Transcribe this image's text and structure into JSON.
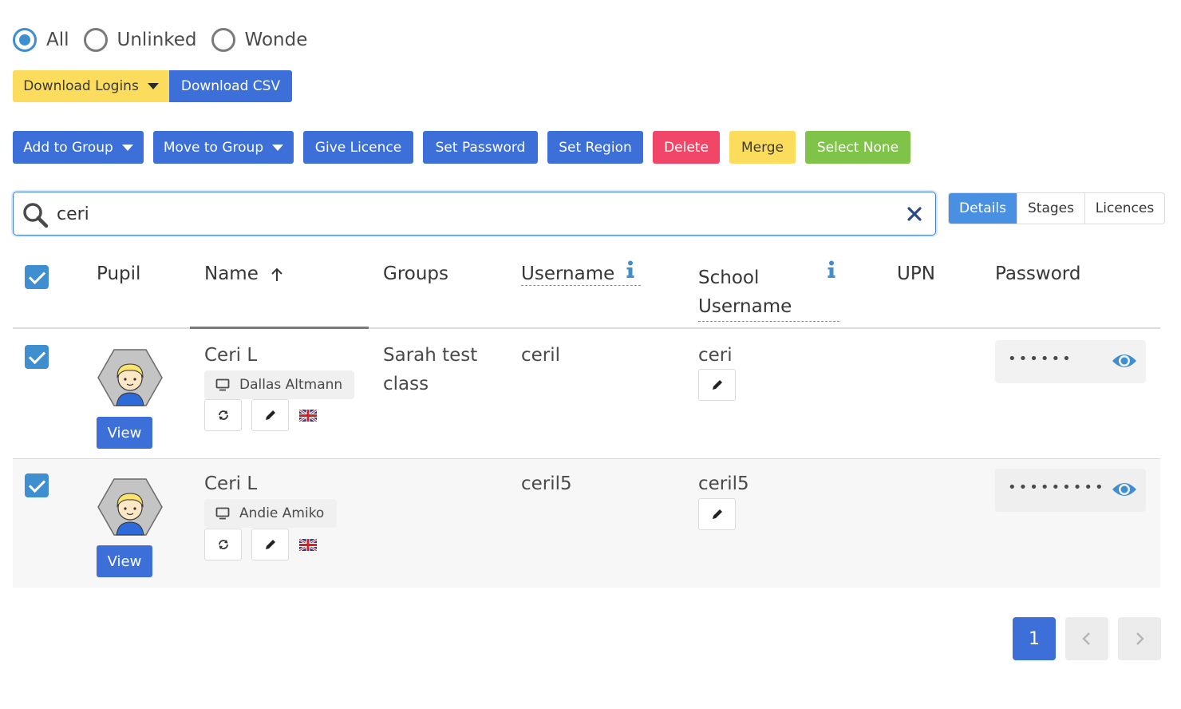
{
  "filters": {
    "options": [
      {
        "label": "All",
        "checked": true
      },
      {
        "label": "Unlinked",
        "checked": false
      },
      {
        "label": "Wonde",
        "checked": false
      }
    ]
  },
  "downloads": {
    "download_logins": "Download Logins",
    "download_csv": "Download CSV"
  },
  "actions": {
    "add_to_group": "Add to Group",
    "move_to_group": "Move to Group",
    "give_licence": "Give Licence",
    "set_password": "Set Password",
    "set_region": "Set Region",
    "delete": "Delete",
    "merge": "Merge",
    "select_none": "Select None"
  },
  "search": {
    "value": "ceri",
    "placeholder": ""
  },
  "view_tabs": [
    {
      "label": "Details",
      "active": true
    },
    {
      "label": "Stages",
      "active": false
    },
    {
      "label": "Licences",
      "active": false
    }
  ],
  "table": {
    "headers": {
      "pupil": "Pupil",
      "name": "Name",
      "groups": "Groups",
      "username": "Username",
      "school_username_1": "School",
      "school_username_2": "Username",
      "upn": "UPN",
      "password": "Password"
    },
    "sort": {
      "column": "Name",
      "direction": "ascending"
    },
    "rows": [
      {
        "checked": true,
        "view_label": "View",
        "name": "Ceri L",
        "teacher": "Dallas Altmann",
        "groups_1": "Sarah test",
        "groups_2": "class",
        "username": "ceril",
        "school_username": "ceri",
        "upn": "",
        "password_mask": "••••••",
        "flag": "uk-flag-icon"
      },
      {
        "checked": true,
        "view_label": "View",
        "name": "Ceri L",
        "teacher": "Andie Amiko",
        "groups_1": "",
        "groups_2": "",
        "username": "ceril5",
        "school_username": "ceril5",
        "upn": "",
        "password_mask": "•••••••••",
        "flag": "uk-flag-icon"
      }
    ]
  },
  "pagination": {
    "current": "1"
  },
  "colors": {
    "primary": "#3c6fd7",
    "info": "#3e8ed0",
    "warning": "#fcdc5c",
    "danger": "#f14668",
    "success": "#7fc449"
  }
}
